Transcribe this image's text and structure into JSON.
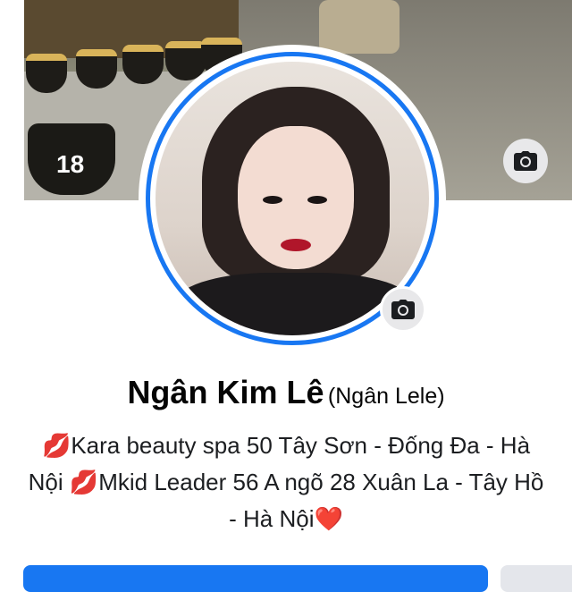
{
  "cover": {
    "bowl_number": "18"
  },
  "profile": {
    "name": "Ngân Kim Lê",
    "alt_name": "(Ngân Lele)",
    "bio_line_1": "Kara beauty spa 50 Tây Sơn - Đống Đa - Hà",
    "bio_line_2_start": "Nội ",
    "bio_line_2_rest": "Mkid Leader 56 A ngõ 28 Xuân La - Tây Hồ",
    "bio_line_3": "- Hà Nội",
    "lips_emoji": "💋",
    "heart_emoji": "❤️"
  },
  "icons": {
    "cover_camera": "camera-icon",
    "avatar_camera": "camera-icon"
  },
  "colors": {
    "accent": "#1877f2",
    "secondary_button": "#e4e6eb",
    "text": "#050505"
  }
}
